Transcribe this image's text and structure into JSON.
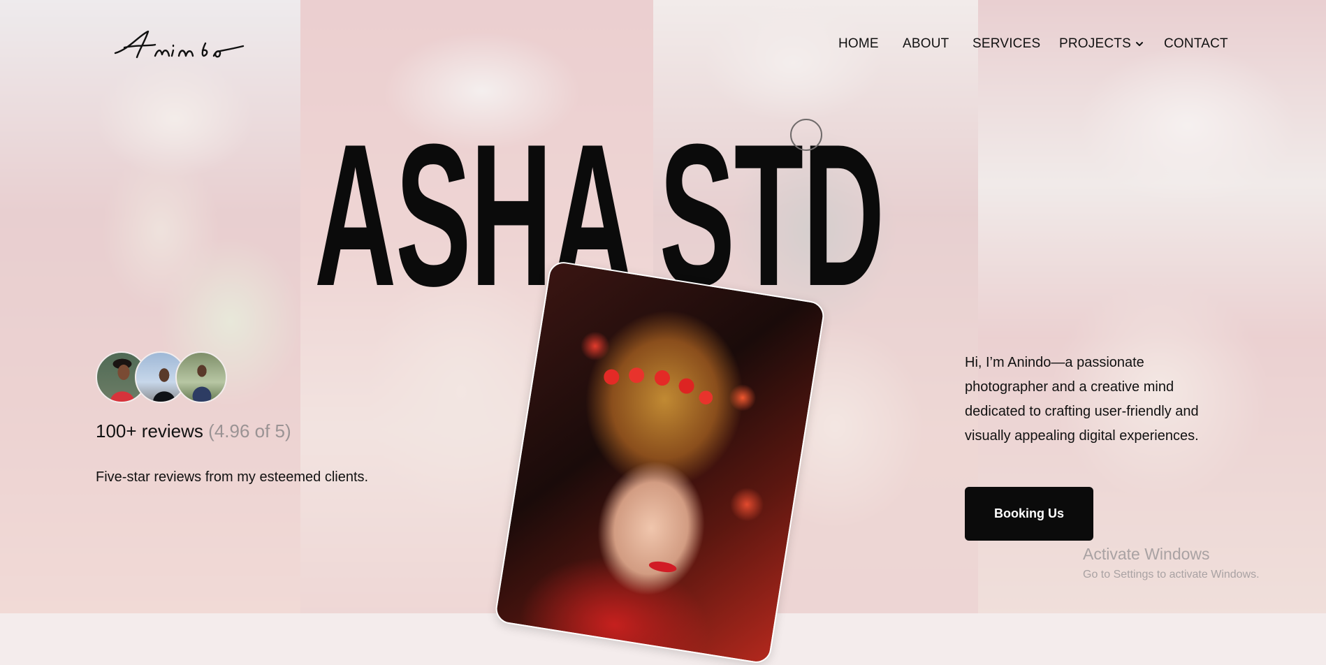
{
  "brand": {
    "logo_text": "Anindo"
  },
  "nav": {
    "items": [
      {
        "label": "HOME"
      },
      {
        "label": "ABOUT"
      },
      {
        "label": "SERVICES"
      },
      {
        "label": "PROJECTS"
      },
      {
        "label": "CONTACT"
      }
    ]
  },
  "hero": {
    "title": "ASHA STD"
  },
  "reviews": {
    "count_label": "100+ reviews",
    "rating_label": "(4.96 of 5)",
    "description": "Five-star reviews from my esteemed clients."
  },
  "intro": {
    "text": "Hi, I’m Anindo—a passionate photographer and a creative mind dedicated to crafting user-friendly and visually appealing digital experiences.",
    "cta_label": "Booking Us"
  },
  "system_watermark": {
    "title": "Activate Windows",
    "subtitle": "Go to Settings to activate Windows."
  },
  "icons": {
    "projects_dropdown": "chevron-down-icon",
    "cursor": "cursor-ring-icon"
  },
  "colors": {
    "text": "#111111",
    "button_bg": "#0b0b0b",
    "button_text": "#ffffff",
    "rating_muted": "#9a9394"
  }
}
